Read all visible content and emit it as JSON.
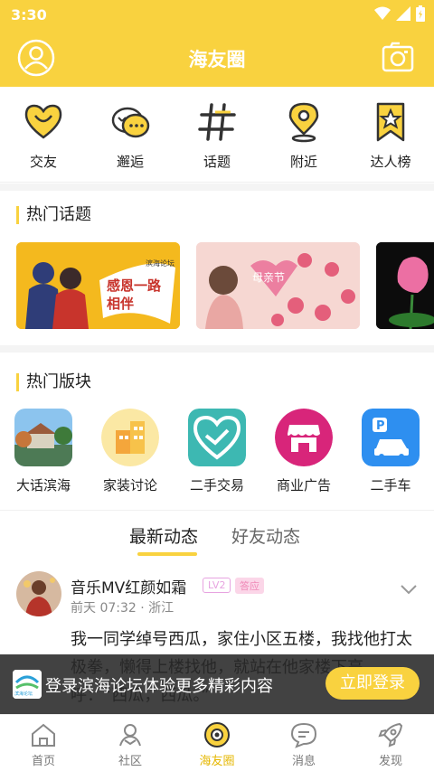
{
  "status_bar": {
    "time": "3:30"
  },
  "header": {
    "title": "海友圈"
  },
  "quick_actions": [
    {
      "label": "交友",
      "icon": "heart-chat-icon"
    },
    {
      "label": "邂逅",
      "icon": "encounter-chat-icon"
    },
    {
      "label": "话题",
      "icon": "hashtag-icon"
    },
    {
      "label": "附近",
      "icon": "location-pin-icon"
    },
    {
      "label": "达人榜",
      "icon": "star-bookmark-icon"
    }
  ],
  "hot_topics": {
    "title": "热门话题",
    "cards": [
      {
        "text": "感恩一路相伴",
        "badge": "滨海论坛"
      },
      {
        "text": "母亲节"
      },
      {
        "text": ""
      }
    ]
  },
  "hot_boards": {
    "title": "热门版块",
    "items": [
      {
        "label": "大话滨海"
      },
      {
        "label": "家装讨论"
      },
      {
        "label": "二手交易"
      },
      {
        "label": "商业广告"
      },
      {
        "label": "二手车"
      }
    ]
  },
  "feed_tabs": {
    "latest": "最新动态",
    "friends": "好友动态"
  },
  "post": {
    "username": "音乐MV红颜如霜",
    "level": "LV2",
    "badge": "答应",
    "time": "前天 07:32",
    "location": "浙江",
    "text": "我一同学绰号西瓜，家住小区五楼，我找他打太极拳，懒得上楼找他，就站在他家楼下高呼：“西瓜，西瓜。”"
  },
  "login_banner": {
    "message": "登录滨海论坛体验更多精彩内容",
    "button": "立即登录",
    "logo_text": "滨海论坛"
  },
  "bottom_nav": [
    {
      "label": "首页"
    },
    {
      "label": "社区"
    },
    {
      "label": "海友圈"
    },
    {
      "label": "消息"
    },
    {
      "label": "发现"
    }
  ],
  "colors": {
    "accent": "#f9d23f",
    "badge_level": "#e7a3e0",
    "badge_tag": "#f08ab8"
  }
}
